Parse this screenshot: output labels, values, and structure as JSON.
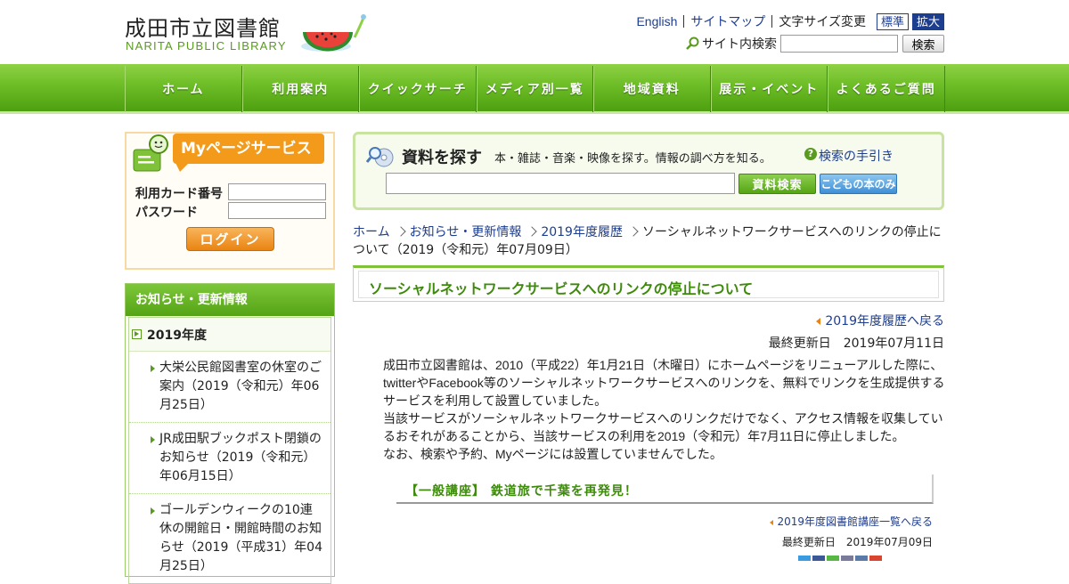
{
  "header": {
    "logo_jp": "成田市立図書館",
    "logo_en": "NARITA PUBLIC LIBRARY",
    "links": [
      "English",
      "サイトマップ"
    ],
    "font_size_label": "文字サイズ変更",
    "font_std": "標準",
    "font_big": "拡大",
    "site_search_label": "サイト内検索",
    "site_search_button": "検索"
  },
  "nav": [
    "ホーム",
    "利用案内",
    "クイックサーチ",
    "メディア別一覧",
    "地域資料",
    "展示・イベント",
    "よくあるご質問"
  ],
  "mypage": {
    "title": "Myページサービス",
    "card_label": "利用カード番号",
    "password_label": "パスワード",
    "login": "ログイン"
  },
  "news": {
    "title": "お知らせ・更新情報",
    "year": "2019年度",
    "items": [
      "大栄公民館図書室の休室のご案内（2019（令和元）年06月25日）",
      "JR成田駅ブックポスト閉鎖のお知らせ（2019（令和元）年06月15日）",
      "ゴールデンウィークの10連休の開館日・開館時間のお知らせ（2019（平成31）年04月25日）"
    ]
  },
  "find": {
    "title": "資料を探す",
    "desc": "本・雑誌・音楽・映像を探す。情報の調べ方を知る。",
    "help": "検索の手引き",
    "search_button": "資料検索",
    "kids_button": "こどもの本のみ"
  },
  "breadcrumb": {
    "items": [
      "ホーム",
      "お知らせ・更新情報",
      "2019年度履歴"
    ],
    "current": "ソーシャルネットワークサービスへのリンクの停止について（2019（令和元）年07月09日）"
  },
  "page": {
    "title": "ソーシャルネットワークサービスへのリンクの停止について",
    "back": "2019年度履歴へ戻る",
    "updated": "最終更新日　2019年07月11日",
    "paragraphs": [
      "成田市立図書館は、2010（平成22）年1月21日（木曜日）にホームページをリニューアルした際に、twitterやFacebook等のソーシャルネットワークサービスへのリンクを、無料でリンクを生成提供するサービスを利用して設置していました。",
      "当該サービスがソーシャルネットワークサービスへのリンクだけでなく、アクセス情報を収集しているおそれがあることから、当該サービスの利用を2019（令和元）年7月11日に停止しました。",
      "なお、検索や予約、Myページには設置していませんでした。"
    ]
  },
  "embedded": {
    "title": "【一般講座】 鉄道旅で千葉を再発見！",
    "back": "2019年度図書館講座一覧へ戻る",
    "updated": "最終更新日　2019年07月09日"
  },
  "colors": {
    "brand_green": "#6cbd26",
    "accent_orange": "#f39a1a",
    "link_blue": "#1d3d8f"
  }
}
